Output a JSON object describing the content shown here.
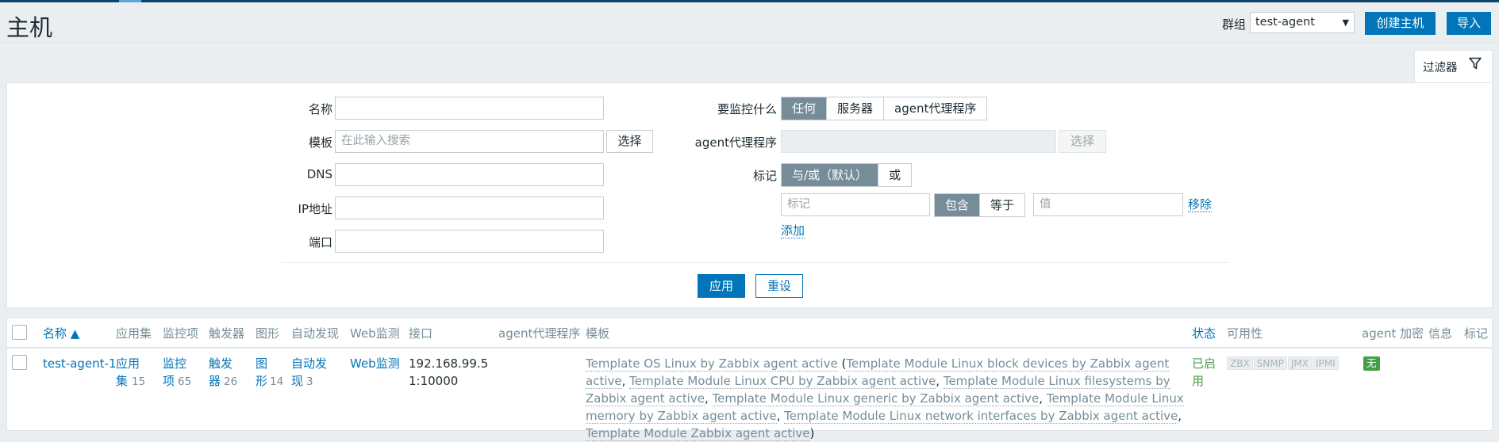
{
  "header": {
    "title": "主机",
    "group_label": "群组",
    "group_selected": "test-agent",
    "create_button": "创建主机",
    "import_button": "导入"
  },
  "filter": {
    "tab_label": "过滤器",
    "name_label": "名称",
    "name_value": "",
    "template_label": "模板",
    "template_placeholder": "在此输入搜索",
    "template_select": "选择",
    "dns_label": "DNS",
    "dns_value": "",
    "ip_label": "IP地址",
    "ip_value": "",
    "port_label": "端口",
    "port_value": "",
    "monitor_label": "要监控什么",
    "monitor_options": [
      "任何",
      "服务器",
      "agent代理程序"
    ],
    "monitor_selected": "任何",
    "proxy_label": "agent代理程序",
    "proxy_value": "",
    "proxy_select": "选择",
    "tags_label": "标记",
    "tags_mode_options": [
      "与/或（默认）",
      "或"
    ],
    "tags_mode_selected": "与/或（默认）",
    "tag_name_placeholder": "标记",
    "tag_operator_options": [
      "包含",
      "等于"
    ],
    "tag_operator_selected": "包含",
    "tag_value_placeholder": "值",
    "remove_link": "移除",
    "add_link": "添加",
    "apply_button": "应用",
    "reset_button": "重设"
  },
  "table": {
    "columns": [
      "名称 ▲",
      "应用集",
      "监控项",
      "触发器",
      "图形",
      "自动发现",
      "Web监测",
      "接口",
      "agent代理程序",
      "模板",
      "状态",
      "可用性",
      "agent 加密",
      "信息",
      "标记"
    ],
    "sort_column": "名称",
    "rows": [
      {
        "name": "test-agent-1",
        "applications_label": "应用集",
        "applications_count": "15",
        "items_label": "监控项",
        "items_count": "65",
        "triggers_label": "触发器",
        "triggers_count": "26",
        "graphs_label": "图形",
        "graphs_count": "14",
        "discovery_label": "自动发现",
        "discovery_count": "3",
        "web_label": "Web监测",
        "interface": "192.168.99.51:10000",
        "proxy": "",
        "template_main": "Template OS Linux by Zabbix agent active",
        "templates_linked": [
          "Template Module Linux block devices by Zabbix agent active",
          "Template Module Linux CPU by Zabbix agent active",
          "Template Module Linux filesystems by Zabbix agent active",
          "Template Module Linux generic by Zabbix agent active",
          "Template Module Linux memory by Zabbix agent active",
          "Template Module Linux network interfaces by Zabbix agent active",
          "Template Module Zabbix agent active"
        ],
        "status": "已启用",
        "availability": [
          "ZBX",
          "SNMP",
          "JMX",
          "IPMI"
        ],
        "encryption": "无",
        "info": "",
        "tags": ""
      }
    ]
  },
  "colors": {
    "accent": "#0275b8",
    "topbar": "#0a466a",
    "segment_active": "#768d99",
    "enabled": "#429e47"
  }
}
